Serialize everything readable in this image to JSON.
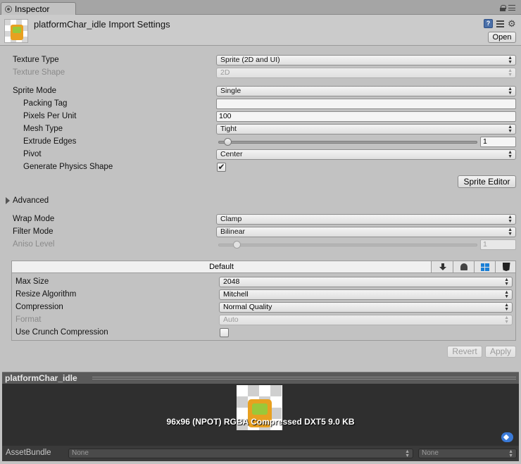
{
  "tab": {
    "label": "Inspector"
  },
  "header": {
    "title": "platformChar_idle Import Settings",
    "open_label": "Open",
    "help_glyph": "?",
    "gear_glyph": "⚙"
  },
  "settings": {
    "texture_type": {
      "label": "Texture Type",
      "value": "Sprite (2D and UI)"
    },
    "texture_shape": {
      "label": "Texture Shape",
      "value": "2D"
    },
    "sprite_mode": {
      "label": "Sprite Mode",
      "value": "Single"
    },
    "packing_tag": {
      "label": "Packing Tag",
      "value": ""
    },
    "pixels_per_unit": {
      "label": "Pixels Per Unit",
      "value": "100"
    },
    "mesh_type": {
      "label": "Mesh Type",
      "value": "Tight"
    },
    "extrude_edges": {
      "label": "Extrude Edges",
      "value": "1"
    },
    "pivot": {
      "label": "Pivot",
      "value": "Center"
    },
    "generate_physics_shape": {
      "label": "Generate Physics Shape",
      "checked": true,
      "check_glyph": "✔"
    },
    "sprite_editor_label": "Sprite Editor",
    "advanced_label": "Advanced",
    "wrap_mode": {
      "label": "Wrap Mode",
      "value": "Clamp"
    },
    "filter_mode": {
      "label": "Filter Mode",
      "value": "Bilinear"
    },
    "aniso_level": {
      "label": "Aniso Level",
      "value": "1"
    }
  },
  "platform": {
    "default_tab": "Default",
    "max_size": {
      "label": "Max Size",
      "value": "2048"
    },
    "resize_algorithm": {
      "label": "Resize Algorithm",
      "value": "Mitchell"
    },
    "compression": {
      "label": "Compression",
      "value": "Normal Quality"
    },
    "format": {
      "label": "Format",
      "value": "Auto"
    },
    "use_crunch": {
      "label": "Use Crunch Compression",
      "checked": false
    }
  },
  "actions": {
    "revert": "Revert",
    "apply": "Apply"
  },
  "preview": {
    "title": "platformChar_idle",
    "info": "96x96 (NPOT)  RGBA Compressed DXT5   9.0 KB"
  },
  "assetbundle": {
    "label": "AssetBundle",
    "name": "None",
    "variant": "None"
  },
  "dropdown_arrows": {
    "up": "▲",
    "down": "▼"
  }
}
